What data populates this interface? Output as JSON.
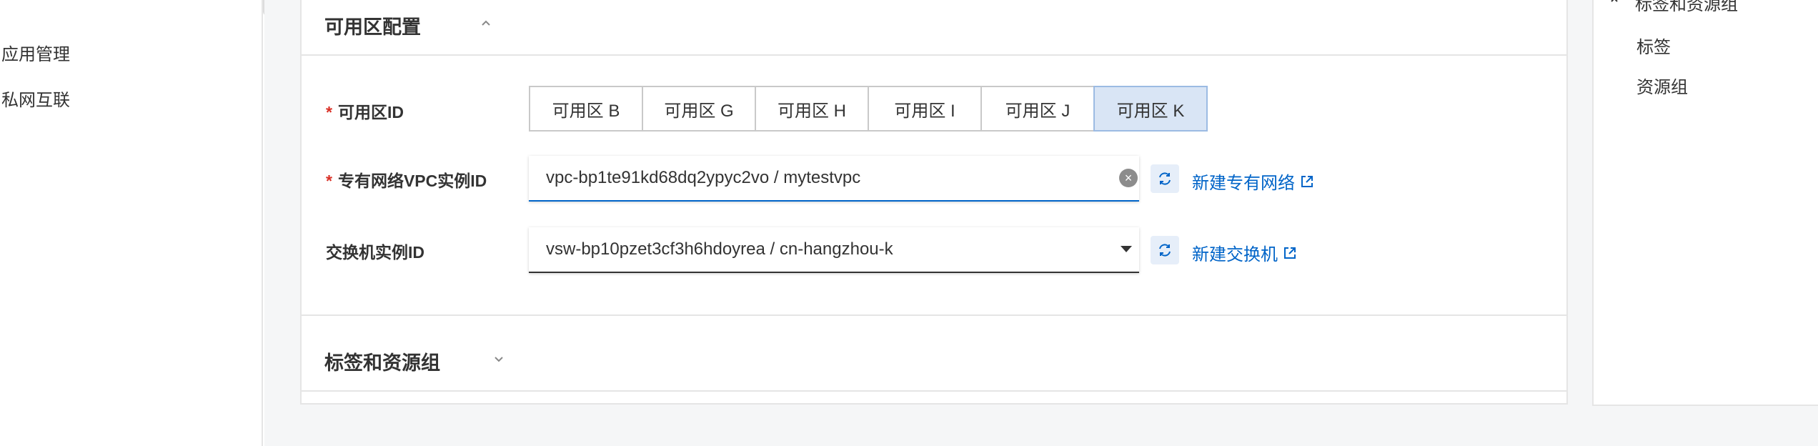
{
  "left_nav": {
    "items": [
      {
        "label": "应用管理"
      },
      {
        "label": "私网互联"
      }
    ]
  },
  "availability_section": {
    "title": "可用区配置",
    "zone_field": {
      "label": "可用区ID",
      "required_mark": "*",
      "options": [
        "可用区 B",
        "可用区 G",
        "可用区 H",
        "可用区 I",
        "可用区 J",
        "可用区 K"
      ],
      "selected": "可用区 K"
    },
    "vpc_field": {
      "label": "专有网络VPC实例ID",
      "required_mark": "*",
      "value": "vpc-bp1te91kd68dq2ypyc2vo / mytestvpc",
      "create_link": "新建专有网络"
    },
    "vswitch_field": {
      "label": "交换机实例ID",
      "value": "vsw-bp10pzet3cf3h6hdoyrea / cn-hangzhou-k",
      "create_link": "新建交换机"
    }
  },
  "tags_section": {
    "title": "标签和资源组"
  },
  "right_toc": {
    "items": [
      {
        "label": "标签和资源组"
      },
      {
        "label": "标签"
      },
      {
        "label": "资源组"
      }
    ]
  },
  "colors": {
    "accent": "#0064c8",
    "selected_bg": "#d9e5f5",
    "required": "#d93026"
  }
}
